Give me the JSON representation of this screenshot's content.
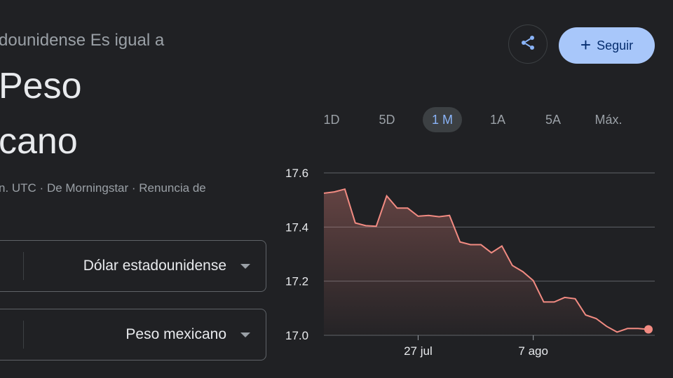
{
  "header": {
    "subtitle": "dounidense Es igual a",
    "result_line1": "Peso",
    "result_line2": "cano",
    "meta": "n. UTC · De Morningstar · Renuncia de"
  },
  "actions": {
    "share_icon": "share-icon",
    "follow_label": "Seguir",
    "follow_icon": "plus-icon"
  },
  "range_tabs": [
    {
      "label": "1D",
      "active": false
    },
    {
      "label": "5D",
      "active": false
    },
    {
      "label": "1 M",
      "active": true
    },
    {
      "label": "1A",
      "active": false
    },
    {
      "label": "5A",
      "active": false
    },
    {
      "label": "Máx.",
      "active": false
    }
  ],
  "converter": {
    "from_currency": "Dólar estadounidense",
    "to_currency": "Peso mexicano"
  },
  "colors": {
    "line": "#f28b82",
    "accent": "#8ab4f8",
    "button_bg": "#a8c7fa"
  },
  "chart_data": {
    "type": "area",
    "y_ticks": [
      "17.6",
      "17.4",
      "17.2",
      "17.0"
    ],
    "x_ticks": [
      "27 jul",
      "7 ago"
    ],
    "ylim": [
      17.0,
      17.6
    ],
    "grid": true,
    "values": [
      17.525,
      17.53,
      17.54,
      17.415,
      17.405,
      17.403,
      17.515,
      17.47,
      17.47,
      17.44,
      17.443,
      17.438,
      17.443,
      17.345,
      17.335,
      17.335,
      17.305,
      17.33,
      17.258,
      17.235,
      17.202,
      17.123,
      17.123,
      17.14,
      17.135,
      17.075,
      17.062,
      17.033,
      17.012,
      17.025,
      17.025,
      17.022
    ]
  }
}
